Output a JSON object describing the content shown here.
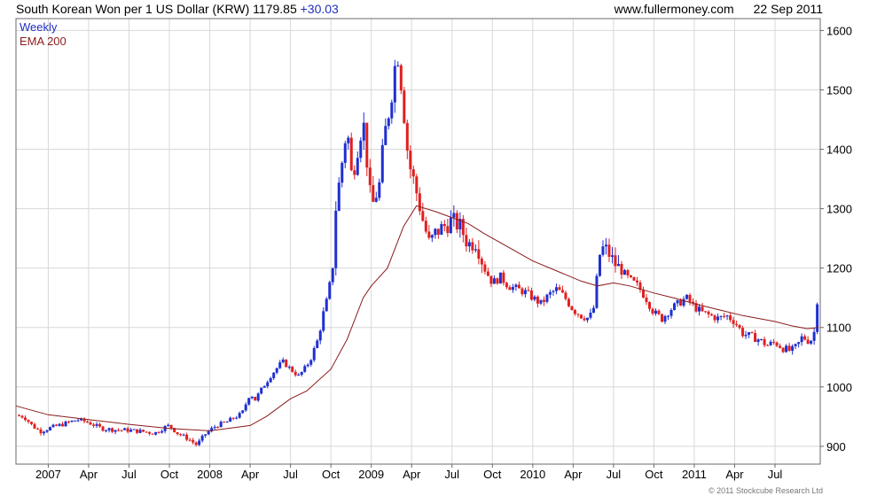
{
  "header": {
    "title": "South Korean Won per 1 US Dollar (KRW)",
    "last_value": "1179.85",
    "change": "+30.03",
    "site": "www.fullermoney.com",
    "date": "22 Sep 2011"
  },
  "footer": {
    "copyright": "© 2011 Stockcube Research Ltd"
  },
  "colors": {
    "up": "#1f2fd0",
    "down": "#e02020",
    "ema": "#8b1a1a",
    "legend_weekly": "#1f2fbf",
    "legend_ema": "#8b1a1a",
    "grid": "#d8d8d8"
  },
  "chart_data": {
    "type": "candlestick",
    "interval": "Weekly",
    "legend": [
      {
        "name": "Weekly",
        "color": "#1f2fbf"
      },
      {
        "name": "EMA 200",
        "color": "#8b1a1a"
      }
    ],
    "xlim": [
      2006.8,
      2011.78
    ],
    "ylim": [
      870,
      1620
    ],
    "y_ticks": [
      900,
      1000,
      1100,
      1200,
      1300,
      1400,
      1500,
      1600
    ],
    "x_ticks": [
      {
        "label": "2007",
        "x": 2007.0
      },
      {
        "label": "Apr",
        "x": 2007.25
      },
      {
        "label": "Jul",
        "x": 2007.5
      },
      {
        "label": "Oct",
        "x": 2007.75
      },
      {
        "label": "2008",
        "x": 2008.0
      },
      {
        "label": "Apr",
        "x": 2008.25
      },
      {
        "label": "Jul",
        "x": 2008.5
      },
      {
        "label": "Oct",
        "x": 2008.75
      },
      {
        "label": "2009",
        "x": 2009.0
      },
      {
        "label": "Apr",
        "x": 2009.25
      },
      {
        "label": "Jul",
        "x": 2009.5
      },
      {
        "label": "Oct",
        "x": 2009.75
      },
      {
        "label": "2010",
        "x": 2010.0
      },
      {
        "label": "Apr",
        "x": 2010.25
      },
      {
        "label": "Jul",
        "x": 2010.5
      },
      {
        "label": "Oct",
        "x": 2010.75
      },
      {
        "label": "2011",
        "x": 2011.0
      },
      {
        "label": "Apr",
        "x": 2011.25
      },
      {
        "label": "Jul",
        "x": 2011.5
      }
    ],
    "price_path": [
      [
        2006.8,
        952
      ],
      [
        2006.85,
        950
      ],
      [
        2006.9,
        935
      ],
      [
        2006.95,
        925
      ],
      [
        2007.0,
        930
      ],
      [
        2007.1,
        938
      ],
      [
        2007.18,
        945
      ],
      [
        2007.25,
        940
      ],
      [
        2007.33,
        930
      ],
      [
        2007.4,
        928
      ],
      [
        2007.5,
        927
      ],
      [
        2007.58,
        925
      ],
      [
        2007.66,
        922
      ],
      [
        2007.72,
        932
      ],
      [
        2007.75,
        935
      ],
      [
        2007.8,
        922
      ],
      [
        2007.87,
        912
      ],
      [
        2007.92,
        902
      ],
      [
        2007.97,
        920
      ],
      [
        2008.04,
        935
      ],
      [
        2008.1,
        940
      ],
      [
        2008.15,
        948
      ],
      [
        2008.2,
        955
      ],
      [
        2008.25,
        990
      ],
      [
        2008.28,
        978
      ],
      [
        2008.33,
        1000
      ],
      [
        2008.38,
        1020
      ],
      [
        2008.45,
        1043
      ],
      [
        2008.5,
        1030
      ],
      [
        2008.55,
        1018
      ],
      [
        2008.6,
        1035
      ],
      [
        2008.63,
        1050
      ],
      [
        2008.67,
        1080
      ],
      [
        2008.7,
        1120
      ],
      [
        2008.73,
        1150
      ],
      [
        2008.76,
        1200
      ],
      [
        2008.78,
        1300
      ],
      [
        2008.82,
        1380
      ],
      [
        2008.85,
        1440
      ],
      [
        2008.88,
        1350
      ],
      [
        2008.92,
        1410
      ],
      [
        2008.95,
        1450
      ],
      [
        2009.0,
        1300
      ],
      [
        2009.05,
        1340
      ],
      [
        2009.08,
        1420
      ],
      [
        2009.12,
        1480
      ],
      [
        2009.16,
        1570
      ],
      [
        2009.19,
        1500
      ],
      [
        2009.23,
        1380
      ],
      [
        2009.27,
        1340
      ],
      [
        2009.32,
        1280
      ],
      [
        2009.36,
        1240
      ],
      [
        2009.4,
        1260
      ],
      [
        2009.45,
        1270
      ],
      [
        2009.5,
        1280
      ],
      [
        2009.55,
        1270
      ],
      [
        2009.6,
        1240
      ],
      [
        2009.65,
        1245
      ],
      [
        2009.7,
        1200
      ],
      [
        2009.75,
        1175
      ],
      [
        2009.8,
        1185
      ],
      [
        2009.85,
        1170
      ],
      [
        2009.9,
        1165
      ],
      [
        2009.95,
        1160
      ],
      [
        2010.0,
        1150
      ],
      [
        2010.05,
        1140
      ],
      [
        2010.1,
        1155
      ],
      [
        2010.15,
        1165
      ],
      [
        2010.2,
        1150
      ],
      [
        2010.25,
        1130
      ],
      [
        2010.3,
        1120
      ],
      [
        2010.35,
        1115
      ],
      [
        2010.38,
        1135
      ],
      [
        2010.41,
        1220
      ],
      [
        2010.44,
        1235
      ],
      [
        2010.47,
        1225
      ],
      [
        2010.5,
        1210
      ],
      [
        2010.55,
        1195
      ],
      [
        2010.6,
        1180
      ],
      [
        2010.65,
        1170
      ],
      [
        2010.7,
        1150
      ],
      [
        2010.75,
        1125
      ],
      [
        2010.8,
        1115
      ],
      [
        2010.85,
        1130
      ],
      [
        2010.9,
        1140
      ],
      [
        2010.95,
        1150
      ],
      [
        2011.0,
        1135
      ],
      [
        2011.05,
        1125
      ],
      [
        2011.1,
        1120
      ],
      [
        2011.15,
        1115
      ],
      [
        2011.2,
        1120
      ],
      [
        2011.25,
        1110
      ],
      [
        2011.3,
        1090
      ],
      [
        2011.35,
        1085
      ],
      [
        2011.4,
        1080
      ],
      [
        2011.45,
        1070
      ],
      [
        2011.5,
        1075
      ],
      [
        2011.55,
        1065
      ],
      [
        2011.6,
        1060
      ],
      [
        2011.64,
        1070
      ],
      [
        2011.67,
        1085
      ],
      [
        2011.7,
        1078
      ],
      [
        2011.73,
        1080
      ],
      [
        2011.75,
        1100
      ],
      [
        2011.77,
        1180
      ]
    ],
    "ema_200": [
      [
        2006.8,
        968
      ],
      [
        2007.0,
        953
      ],
      [
        2007.25,
        945
      ],
      [
        2007.5,
        937
      ],
      [
        2007.75,
        930
      ],
      [
        2008.0,
        926
      ],
      [
        2008.25,
        935
      ],
      [
        2008.35,
        950
      ],
      [
        2008.5,
        980
      ],
      [
        2008.6,
        993
      ],
      [
        2008.75,
        1030
      ],
      [
        2008.85,
        1080
      ],
      [
        2008.95,
        1150
      ],
      [
        2009.0,
        1170
      ],
      [
        2009.1,
        1200
      ],
      [
        2009.2,
        1270
      ],
      [
        2009.28,
        1305
      ],
      [
        2009.4,
        1295
      ],
      [
        2009.5,
        1285
      ],
      [
        2009.6,
        1275
      ],
      [
        2009.7,
        1258
      ],
      [
        2009.85,
        1235
      ],
      [
        2010.0,
        1212
      ],
      [
        2010.15,
        1195
      ],
      [
        2010.3,
        1178
      ],
      [
        2010.4,
        1170
      ],
      [
        2010.5,
        1175
      ],
      [
        2010.6,
        1170
      ],
      [
        2010.75,
        1158
      ],
      [
        2010.9,
        1148
      ],
      [
        2011.0,
        1140
      ],
      [
        2011.15,
        1130
      ],
      [
        2011.3,
        1120
      ],
      [
        2011.5,
        1110
      ],
      [
        2011.6,
        1103
      ],
      [
        2011.7,
        1098
      ],
      [
        2011.77,
        1100
      ]
    ]
  }
}
